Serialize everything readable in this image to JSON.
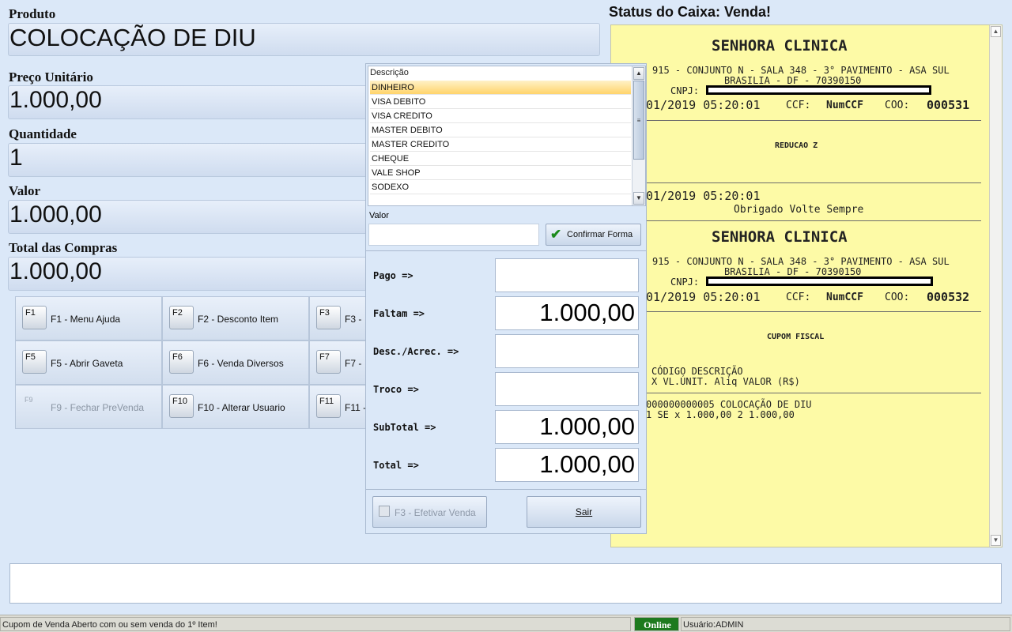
{
  "product": {
    "label": "Produto",
    "value": "COLOCAÇÃO DE DIU"
  },
  "unit_price": {
    "label": "Preço Unitário",
    "value": "1.000,00"
  },
  "quantity": {
    "label": "Quantidade",
    "value": "1"
  },
  "amount": {
    "label": "Valor",
    "value": "1.000,00"
  },
  "total_purchases": {
    "label": "Total das Compras",
    "value": "1.000,00"
  },
  "function_keys": [
    {
      "key": "F1",
      "label": "F1 - Menu Ajuda"
    },
    {
      "key": "F2",
      "label": "F2 - Desconto Item"
    },
    {
      "key": "F3",
      "label": "F3 -"
    },
    {
      "key": "F5",
      "label": "F5 - Abrir Gaveta"
    },
    {
      "key": "F6",
      "label": "F6 - Venda Diversos"
    },
    {
      "key": "F7",
      "label": "F7 -"
    },
    {
      "key": "F9",
      "label": "F9 - Fechar PreVenda"
    },
    {
      "key": "F10",
      "label": "F10  - Alterar Usuario"
    },
    {
      "key": "F11",
      "label": "F11 -"
    }
  ],
  "status_title": "Status do Caixa: Venda!",
  "payment": {
    "list_header": "Descrição",
    "methods": [
      "DINHEIRO",
      "VISA DEBITO",
      "VISA CREDITO",
      "MASTER DEBITO",
      "MASTER CREDITO",
      "CHEQUE",
      "VALE SHOP",
      "SODEXO"
    ],
    "selected_method": "DINHEIRO",
    "value_label": "Valor",
    "value_input": "",
    "confirm_button": "Confirmar Forma",
    "rows": [
      {
        "label": "Pago    =>",
        "value": ""
      },
      {
        "label": "Faltam  =>",
        "value": "1.000,00"
      },
      {
        "label": "Desc./Acrec.  =>",
        "value": ""
      },
      {
        "label": "Troco   =>",
        "value": ""
      },
      {
        "label": "SubTotal  =>",
        "value": "1.000,00"
      },
      {
        "label": "Total   =>",
        "value": "1.000,00"
      }
    ],
    "finalize_button": "F3 - Efetivar Venda",
    "exit_button": "Sair"
  },
  "receipt": {
    "company": "SENHORA CLINICA",
    "address": "915 - CONJUNTO N - SALA 348 - 3° PAVIMENTO - ASA SUL",
    "city": "BRASILIA - DF - 70390150",
    "cnpj_label": "CNPJ:",
    "first": {
      "datetime": "01/2019 05:20:01",
      "ccf_label": "CCF:",
      "ccf_value": "NumCCF",
      "coo_label": "COO:",
      "coo_value": "000531"
    },
    "reducao": "REDUCAO Z",
    "closing_datetime": "01/2019 05:20:01",
    "thanks": "Obrigado Volte Sempre",
    "second": {
      "datetime": "01/2019 05:20:01",
      "ccf_label": "CCF:",
      "ccf_value": "NumCCF",
      "coo_label": "COO:",
      "coo_value": "000532"
    },
    "cupom": "CUPOM FISCAL",
    "header1": "CÓDIGO        DESCRIÇÃO",
    "header2": "X VL.ÚNIT.       Aliq      VALOR (R$)",
    "item_line1": "000000000005  COLOCAÇÃO DE DIU",
    "item_line2": "  1 SE x 1.000,00      2          1.000,00"
  },
  "status_bar": {
    "message": "Cupom de Venda Aberto com ou sem venda do 1º Item!",
    "online": "Online",
    "user": "Usuário:ADMIN"
  },
  "colors": {
    "receipt_bg": "#fdfaa6",
    "online_bg": "#1e7a1e",
    "selected_row": "#ffd46b"
  }
}
